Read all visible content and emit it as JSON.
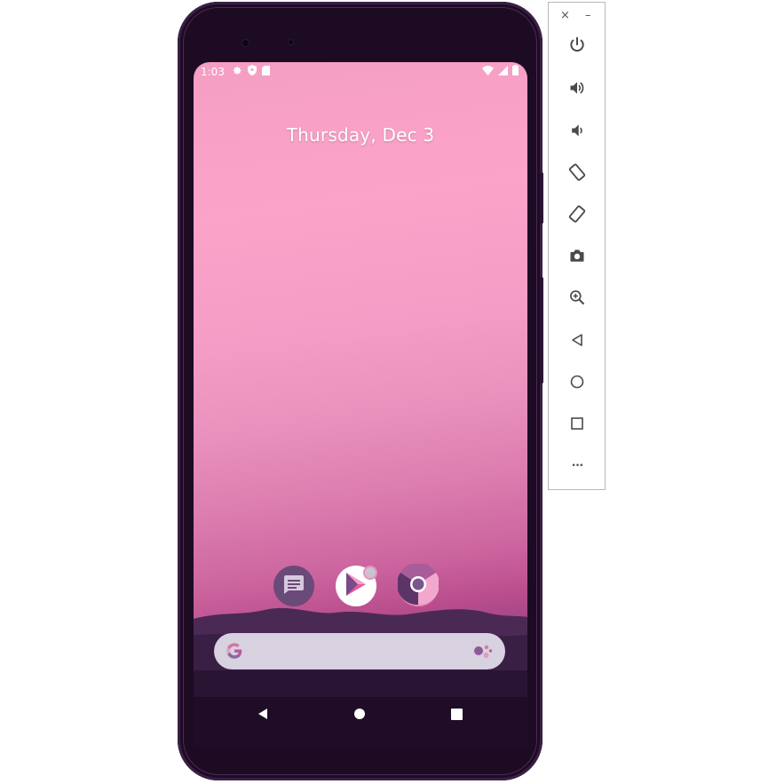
{
  "status_bar": {
    "time": "1:03"
  },
  "home": {
    "date": "Thursday, Dec 3"
  },
  "dock_apps": [
    {
      "name": "Messages",
      "icon": "messages-icon"
    },
    {
      "name": "Play Store",
      "icon": "play-store-icon"
    },
    {
      "name": "Chrome",
      "icon": "chrome-icon"
    }
  ],
  "search_bar": {
    "logo": "google-g-icon",
    "assistant_icon": "google-assistant-icon"
  },
  "nav_bar": {
    "back": "back-icon",
    "home": "home-icon",
    "recents": "recents-icon"
  },
  "toolbar": {
    "close": "×",
    "minimize": "–",
    "more": "•••",
    "buttons": [
      "power-icon",
      "volume-up-icon",
      "volume-down-icon",
      "rotate-left-icon",
      "rotate-right-icon",
      "camera-icon",
      "zoom-icon",
      "back-icon",
      "home-icon",
      "overview-icon",
      "more-icon"
    ]
  },
  "colors": {
    "phone_frame": "#1d0b24",
    "wallpaper_top": "#fca3c9",
    "wallpaper_bottom": "#6d3e7a",
    "search_bar": "#d8d1df"
  }
}
